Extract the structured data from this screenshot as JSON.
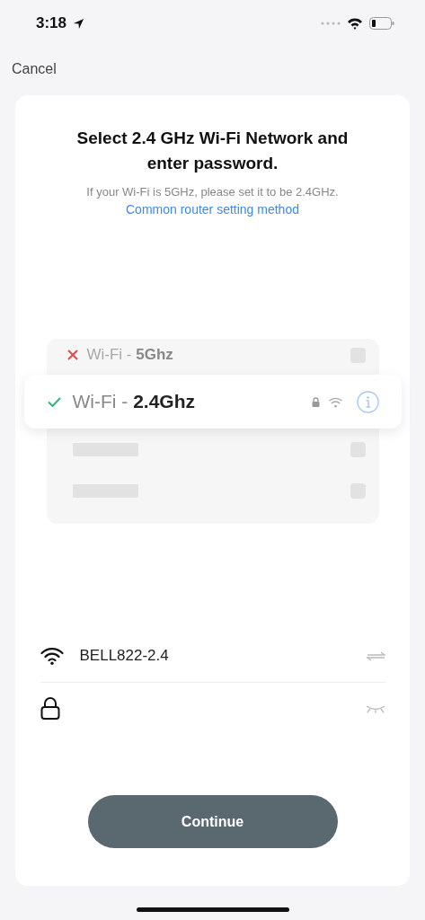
{
  "status_bar": {
    "time": "3:18"
  },
  "nav": {
    "cancel": "Cancel"
  },
  "title": "Select 2.4 GHz Wi-Fi Network and enter password.",
  "hint": "If your Wi-Fi is 5GHz, please set it to be 2.4GHz.",
  "link": "Common router setting method",
  "networks": [
    {
      "label": "Wi-Fi - **5Ghz**",
      "kind": "bad"
    },
    {
      "label": "Wi-Fi - **2.4Ghz**",
      "kind": "ok"
    }
  ],
  "ssid_field": {
    "value": "BELL822-2.4"
  },
  "continue_button": "Continue"
}
